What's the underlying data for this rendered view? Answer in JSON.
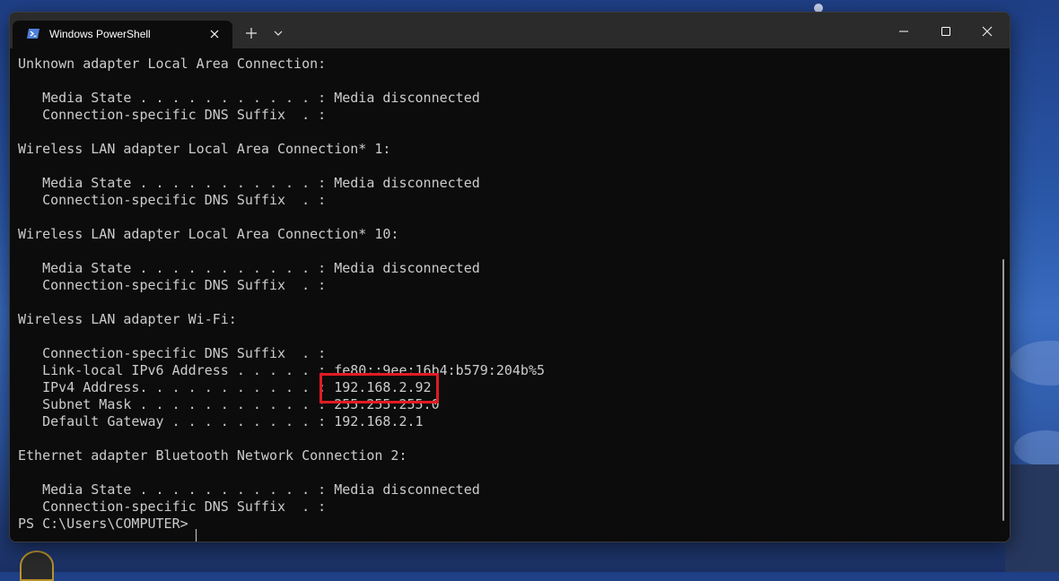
{
  "window": {
    "tab_title": "Windows PowerShell"
  },
  "console": {
    "lines": [
      "Unknown adapter Local Area Connection:",
      "",
      "   Media State . . . . . . . . . . . : Media disconnected",
      "   Connection-specific DNS Suffix  . :",
      "",
      "Wireless LAN adapter Local Area Connection* 1:",
      "",
      "   Media State . . . . . . . . . . . : Media disconnected",
      "   Connection-specific DNS Suffix  . :",
      "",
      "Wireless LAN adapter Local Area Connection* 10:",
      "",
      "   Media State . . . . . . . . . . . : Media disconnected",
      "   Connection-specific DNS Suffix  . :",
      "",
      "Wireless LAN adapter Wi-Fi:",
      "",
      "   Connection-specific DNS Suffix  . :",
      "   Link-local IPv6 Address . . . . . : fe80::9ee:16b4:b579:204b%5",
      "   IPv4 Address. . . . . . . . . . . : 192.168.2.92",
      "   Subnet Mask . . . . . . . . . . . : 255.255.255.0",
      "   Default Gateway . . . . . . . . . : 192.168.2.1",
      "",
      "Ethernet adapter Bluetooth Network Connection 2:",
      "",
      "   Media State . . . . . . . . . . . : Media disconnected",
      "   Connection-specific DNS Suffix  . :",
      "PS C:\\Users\\COMPUTER> "
    ]
  },
  "colors": {
    "highlight": "#e11b22",
    "console_bg": "#0c0c0c",
    "text": "#cccccc"
  },
  "icons": [
    "powershell-icon",
    "close-icon",
    "plus-icon",
    "chevron-down-icon",
    "minimize-icon",
    "maximize-icon",
    "window-close-icon"
  ]
}
